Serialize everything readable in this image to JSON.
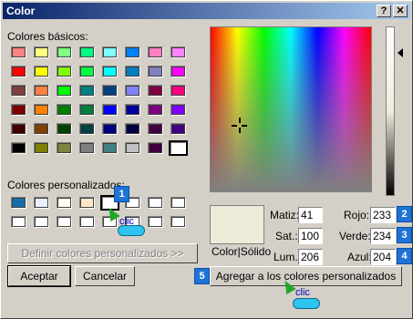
{
  "window": {
    "title": "Color",
    "help_btn": "?",
    "close_btn": "✕"
  },
  "basic": {
    "label": "Colores básicos:",
    "colors": [
      [
        "#ff8080",
        "#ffff80",
        "#80ff80",
        "#00ff80",
        "#80ffff",
        "#0080ff",
        "#ff80c0",
        "#ff80ff"
      ],
      [
        "#ff0000",
        "#ffff00",
        "#80ff00",
        "#00ff40",
        "#00ffff",
        "#0080c0",
        "#8080c0",
        "#ff00ff"
      ],
      [
        "#804040",
        "#ff8040",
        "#00ff00",
        "#008080",
        "#004080",
        "#8080ff",
        "#800040",
        "#ff0080"
      ],
      [
        "#800000",
        "#ff8000",
        "#008000",
        "#008040",
        "#0000ff",
        "#0000a0",
        "#800080",
        "#8000ff"
      ],
      [
        "#400000",
        "#804000",
        "#004000",
        "#004040",
        "#000080",
        "#000040",
        "#400040",
        "#400080"
      ],
      [
        "#000000",
        "#808000",
        "#808040",
        "#808080",
        "#408080",
        "#c0c0c0",
        "#400040",
        "#ffffff"
      ]
    ]
  },
  "custom": {
    "label": "Colores personalizados:",
    "colors": [
      [
        "#156ea8",
        "#e8f0ff",
        "#fffff0",
        "#ffe8c8",
        "#ffffff",
        "#ffffff",
        "#ffffff",
        "#ffffff"
      ],
      [
        "#ffffff",
        "#ffffff",
        "#ffffff",
        "#ffffff",
        "#ffffff",
        "#ffffff",
        "#ffffff",
        "#ffffff"
      ]
    ],
    "define_btn": "Definir colores personalizados >>"
  },
  "buttons": {
    "ok": "Aceptar",
    "cancel": "Cancelar",
    "add": "Agregar a los colores personalizados"
  },
  "preview": {
    "label": "Color|Sólido",
    "color": "#ebebd8"
  },
  "fields": {
    "hue": {
      "label": "Matiz:",
      "value": "41"
    },
    "sat": {
      "label": "Sat.:",
      "value": "100"
    },
    "lum": {
      "label": "Lum.:",
      "value": "206"
    },
    "red": {
      "label": "Rojo:",
      "value": "233"
    },
    "green": {
      "label": "Verde:",
      "value": "234"
    },
    "blue": {
      "label": "Azul:",
      "value": "204"
    }
  },
  "badges": [
    "1",
    "2",
    "3",
    "4",
    "5"
  ],
  "cursor_text": "clic"
}
